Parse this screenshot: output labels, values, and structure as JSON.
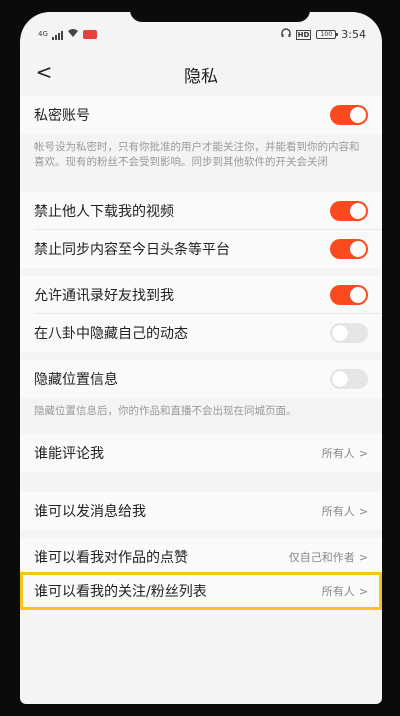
{
  "status_bar": {
    "network": "4G",
    "time": "3:54",
    "battery": "100"
  },
  "nav": {
    "back": "<",
    "title": "隐私"
  },
  "private_account": {
    "label": "私密账号",
    "toggle": "on",
    "note": "帐号设为私密时，只有你批准的用户才能关注你，并能看到你的内容和喜欢。现有的粉丝不会受到影响。同步到其他软件的开关会关闭"
  },
  "settings": [
    {
      "label": "禁止他人下载我的视频",
      "toggle": "on"
    },
    {
      "label": "禁止同步内容至今日头条等平台",
      "toggle": "on"
    },
    {
      "label": "允许通讯录好友找到我",
      "toggle": "on"
    },
    {
      "label": "在八卦中隐藏自己的动态",
      "toggle": "off"
    },
    {
      "label": "隐藏位置信息",
      "toggle": "off"
    }
  ],
  "location_note": "隐藏位置信息后，你的作品和直播不会出现在同城页面。",
  "permissions": [
    {
      "label": "谁能评论我",
      "value": "所有人"
    },
    {
      "label": "谁可以发消息给我",
      "value": "所有人"
    },
    {
      "label": "谁可以看我对作品的点赞",
      "value": "仅自己和作者"
    },
    {
      "label": "谁可以看我的关注/粉丝列表",
      "value": "所有人"
    }
  ],
  "colors": {
    "toggle_on": "#fa4a1e",
    "toggle_off": "#e6e6e6",
    "highlight": "#f6c617"
  }
}
